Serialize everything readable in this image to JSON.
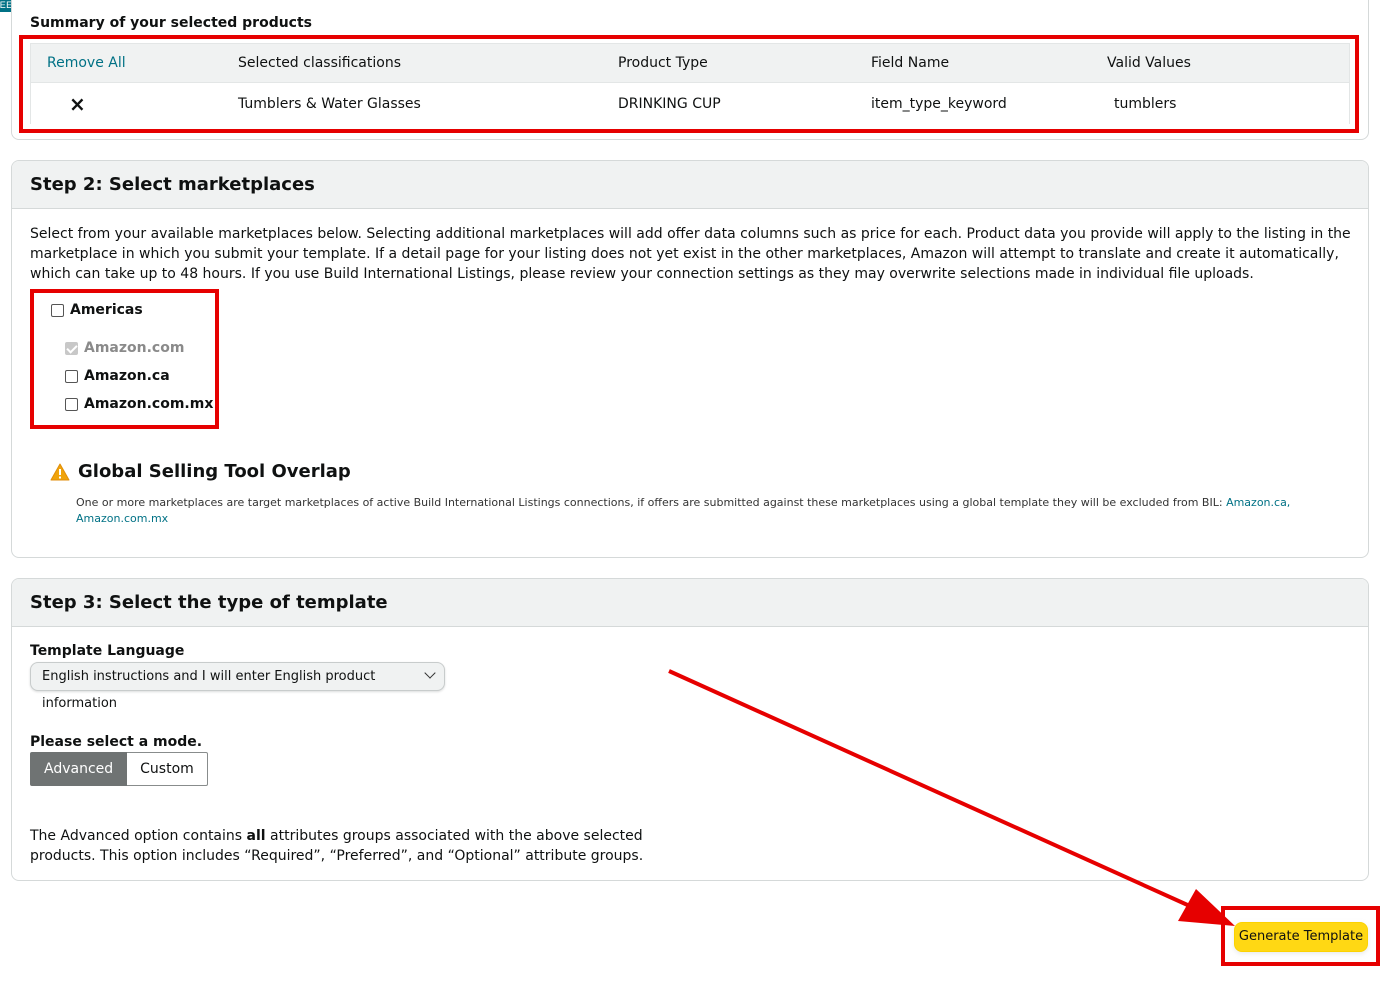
{
  "feedback": {
    "label": "FEEDBACK",
    "close": "×"
  },
  "summary": {
    "title": "Summary of your selected products",
    "headers": {
      "remove_all": "Remove All",
      "classifications": "Selected classifications",
      "product_type": "Product Type",
      "field_name": "Field Name",
      "valid_values": "Valid Values"
    },
    "row": {
      "remove_icon": "×",
      "classification": "Tumblers & Water Glasses",
      "product_type": "DRINKING CUP",
      "field_name": "item_type_keyword",
      "valid_values": "tumblers"
    }
  },
  "step2": {
    "title": "Step 2: Select marketplaces",
    "description": "Select from your available marketplaces below. Selecting additional marketplaces will add offer data columns such as price for each. Product data you provide will apply to the listing in the marketplace in which you submit your template. If a detail page for your listing does not yet exist in the other marketplaces, Amazon will attempt to translate and create it automatically, which can take up to 48 hours. If you use Build International Listings, please review your connection settings as they may overwrite selections made in individual file uploads.",
    "region": "Americas",
    "marketplaces": [
      {
        "label": "Amazon.com",
        "checked": true,
        "disabled": true
      },
      {
        "label": "Amazon.ca",
        "checked": false,
        "disabled": false
      },
      {
        "label": "Amazon.com.mx",
        "checked": false,
        "disabled": false
      }
    ],
    "warning_title": "Global Selling Tool Overlap",
    "warning_text": "One or more marketplaces are target marketplaces of active Build International Listings connections, if offers are submitted against these marketplaces using a global template they will be excluded from BIL:",
    "warning_links": [
      "Amazon.ca,",
      "Amazon.com.mx"
    ]
  },
  "step3": {
    "title": "Step 3: Select the type of template",
    "language_label": "Template Language",
    "language_value": "English instructions and I will enter English product information",
    "mode_label": "Please select a mode.",
    "modes": [
      "Advanced",
      "Custom"
    ],
    "selected_mode": "Advanced",
    "mode_desc_pre": "The Advanced option contains ",
    "mode_desc_bold": "all",
    "mode_desc_post": " attributes groups associated with the above selected products. This option includes “Required”, “Preferred”, and “Optional” attribute groups."
  },
  "generate_button": "Generate Template",
  "colors": {
    "accent_link": "#007185",
    "annotation_red": "#e60000",
    "primary_button": "#ffd814"
  }
}
